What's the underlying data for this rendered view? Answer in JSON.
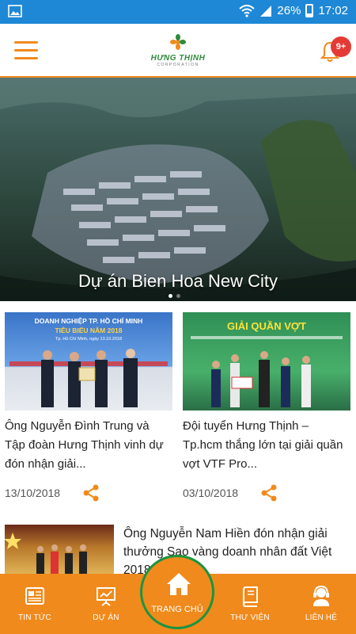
{
  "status_bar": {
    "battery": "26%",
    "time": "17:02"
  },
  "header": {
    "logo_brand": "HƯNG THỊNH",
    "logo_sub": "CORPORATION",
    "notification_badge": "9+"
  },
  "hero": {
    "caption": "Dự án Bien Hoa New City",
    "slide_count": 2,
    "active_slide": 1
  },
  "news": [
    {
      "title": "Ông Nguyễn Đình Trung và Tập đoàn Hưng Thịnh vinh dự đón nhận giải...",
      "date": "13/10/2018",
      "image_banner": "DOANH NGHIỆP TP. HỒ CHÍ MINH",
      "image_banner2": "TIÊU BIỂU NĂM 2018",
      "image_banner3": "Tp. Hồ Chí Minh, ngày 13.10.2018"
    },
    {
      "title": "Đội tuyển Hưng Thịnh – Tp.hcm thắng lớn tại giải quần vợt VTF Pro...",
      "date": "03/10/2018",
      "image_banner": "GIẢI QUẦN VỢT"
    }
  ],
  "featured": {
    "title": "Ông Nguyễn Nam Hiền đón nhận giải thưởng Sao vàng doanh nhân đất Việt 2018"
  },
  "bottom_nav": {
    "news": "TIN TỨC",
    "projects": "DỰ ÁN",
    "home": "TRANG CHỦ",
    "library": "THƯ VIỆN",
    "contact": "LIÊN HỆ"
  },
  "colors": {
    "accent": "#f08a1c",
    "status_bar": "#1e88d6",
    "home_ring": "#1a9440",
    "badge": "#e53935"
  }
}
